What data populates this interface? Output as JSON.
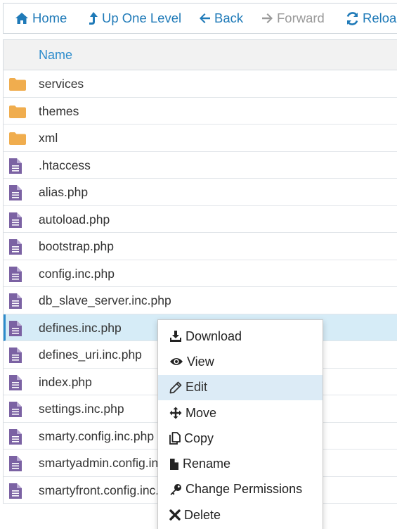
{
  "toolbar": {
    "home": "Home",
    "up": "Up One Level",
    "back": "Back",
    "forward": "Forward",
    "reload": "Reload"
  },
  "table": {
    "header_name": "Name",
    "rows": [
      {
        "name": "services",
        "type": "folder"
      },
      {
        "name": "themes",
        "type": "folder"
      },
      {
        "name": "xml",
        "type": "folder"
      },
      {
        "name": ".htaccess",
        "type": "file"
      },
      {
        "name": "alias.php",
        "type": "file"
      },
      {
        "name": "autoload.php",
        "type": "file"
      },
      {
        "name": "bootstrap.php",
        "type": "file"
      },
      {
        "name": "config.inc.php",
        "type": "file"
      },
      {
        "name": "db_slave_server.inc.php",
        "type": "file"
      },
      {
        "name": "defines.inc.php",
        "type": "file",
        "selected": true
      },
      {
        "name": "defines_uri.inc.php",
        "type": "file"
      },
      {
        "name": "index.php",
        "type": "file"
      },
      {
        "name": "settings.inc.php",
        "type": "file"
      },
      {
        "name": "smarty.config.inc.php",
        "type": "file"
      },
      {
        "name": "smartyadmin.config.inc.php",
        "type": "file"
      },
      {
        "name": "smartyfront.config.inc.php",
        "type": "file"
      }
    ]
  },
  "context_menu": {
    "download": "Download",
    "view": "View",
    "edit": "Edit",
    "move": "Move",
    "copy": "Copy",
    "rename": "Rename",
    "change_permissions": "Change Permissions",
    "delete": "Delete"
  },
  "colors": {
    "accent": "#1f7ab8",
    "folder": "#f0ad4e",
    "file": "#7b62a3",
    "selected_row": "#d6ecf7"
  }
}
